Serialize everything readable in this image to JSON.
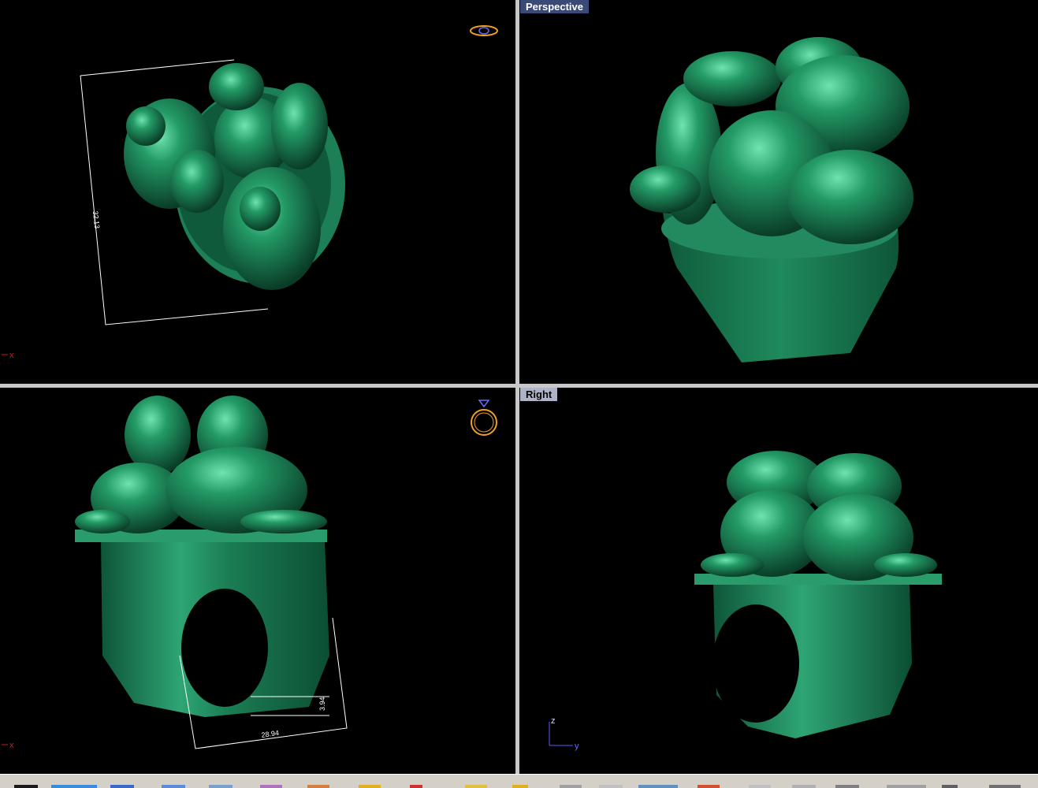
{
  "viewports": {
    "top": {
      "title": ""
    },
    "perspective": {
      "title": "Perspective"
    },
    "front": {
      "title": ""
    },
    "right": {
      "title": "Right"
    }
  },
  "dimensions": {
    "top_width": "32.13",
    "front_height": "3.94",
    "front_width": "28.94"
  },
  "axes": {
    "x": "x",
    "y": "y",
    "z": "z"
  },
  "colors": {
    "model": "#1e7a55",
    "model_light": "#4fd19a",
    "viewport_bg": "#000000",
    "active_title_bg": "#3a4a78",
    "inactive_title_bg": "#aeb4c8"
  },
  "icons": [
    "ring-gem-top-icon",
    "ring-front-icon"
  ]
}
